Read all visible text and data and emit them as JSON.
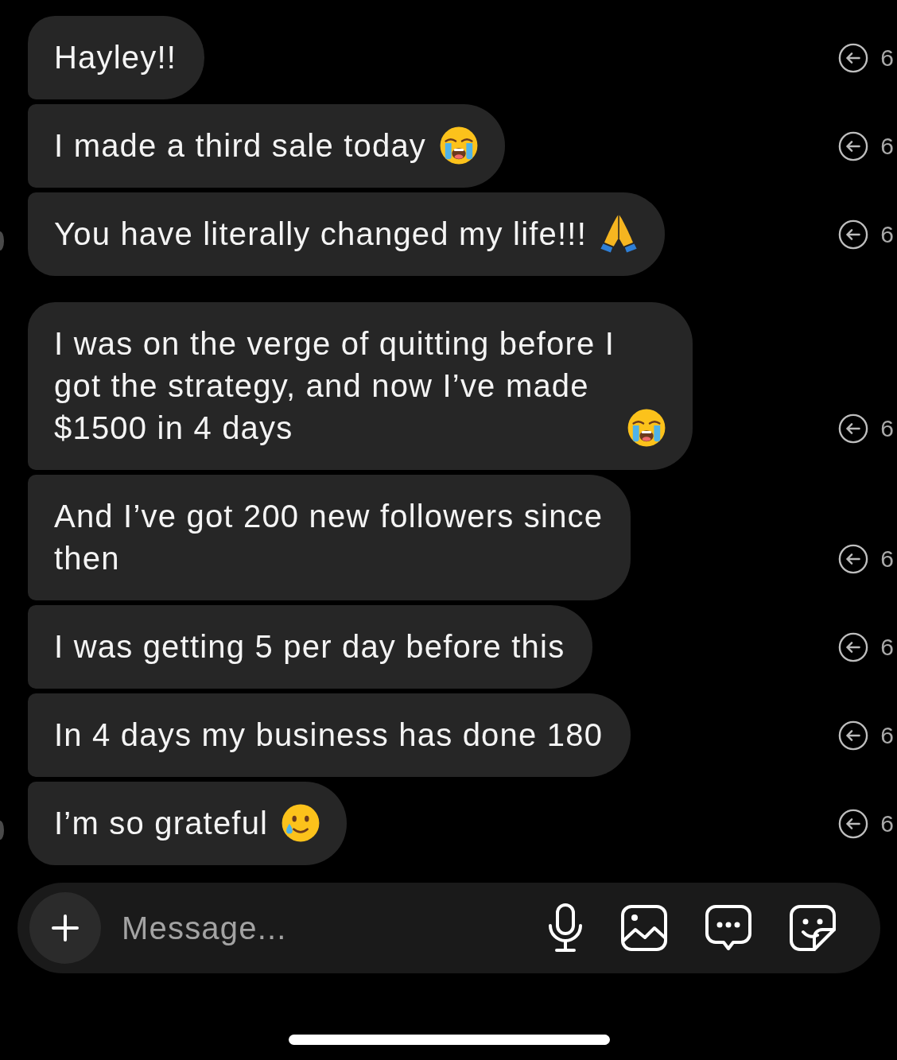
{
  "thread": {
    "groups": [
      {
        "messages": [
          {
            "kind": "plain",
            "text": "Hayley!!",
            "time": "6"
          },
          {
            "kind": "crying",
            "text": "I made a third sale today",
            "time": "6"
          },
          {
            "kind": "praying",
            "text": "You have literally changed my life!!!",
            "time": "6"
          }
        ]
      },
      {
        "messages": [
          {
            "kind": "crying",
            "text": "I was on the verge of quitting before I got the strategy, and now I’ve made $1500 in 4 days",
            "time": "6"
          },
          {
            "kind": "plain",
            "text": "And I’ve got 200 new followers since then",
            "time": "6"
          },
          {
            "kind": "plain",
            "text": "I was getting 5 per day before this",
            "time": "6"
          },
          {
            "kind": "plain",
            "text": "In 4 days my business has done 180",
            "time": "6"
          },
          {
            "kind": "tearful",
            "text": "I’m so grateful",
            "time": "6"
          }
        ]
      }
    ]
  },
  "composer": {
    "placeholder": "Message..."
  }
}
